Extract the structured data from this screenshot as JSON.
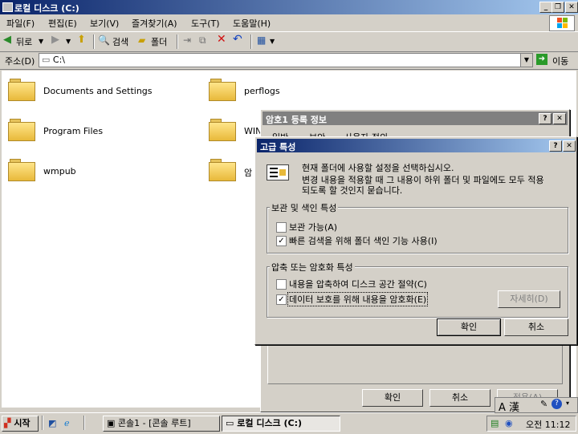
{
  "window": {
    "title": "로컬 디스크 (C:)"
  },
  "menu": [
    "파일(F)",
    "편집(E)",
    "보기(V)",
    "즐겨찾기(A)",
    "도구(T)",
    "도움말(H)"
  ],
  "toolbar": {
    "back": "뒤로",
    "search": "검색",
    "folders": "폴더"
  },
  "address": {
    "label": "주소(D)",
    "value": "C:\\",
    "go": "이동"
  },
  "folders": [
    "Documents and Settings",
    "perflogs",
    "Program Files",
    "WIN",
    "wmpub",
    "암"
  ],
  "bg_dialog": {
    "title": "암호1 등록 정보",
    "tabs": [
      "일반",
      "보안",
      "사용자 정의"
    ],
    "ok": "확인",
    "cancel": "취소",
    "apply": "적용(A)"
  },
  "dialog": {
    "title": "고급 특성",
    "desc1": "현재 폴더에 사용할 설정을 선택하십시오.",
    "desc2": "변경 내용을 적용할 때 그 내용이 하위 폴더 및 파일에도 모두 적용",
    "desc3": "되도록 할 것인지 묻습니다.",
    "group1": "보관 및 색인 특성",
    "archive": "보관 가능(A)",
    "index": "빠른 검색을 위해 폴더 색인 기능 사용(I)",
    "group2": "압축 또는 암호화 특성",
    "compress": "내용을 압축하여 디스크 공간 절약(C)",
    "encrypt": "데이터 보호를 위해 내용을 암호화(E)",
    "details": "자세히(D)",
    "ok": "확인",
    "cancel": "취소"
  },
  "taskbar": {
    "start": "시작",
    "tasks": [
      "콘솔1 - [콘솔 루트]",
      "로컬 디스크 (C:)"
    ],
    "ime": "A 漢",
    "clock": "오전 11:12"
  },
  "colors": {
    "title_active": "#0a246a",
    "title_inactive": "#808080"
  }
}
